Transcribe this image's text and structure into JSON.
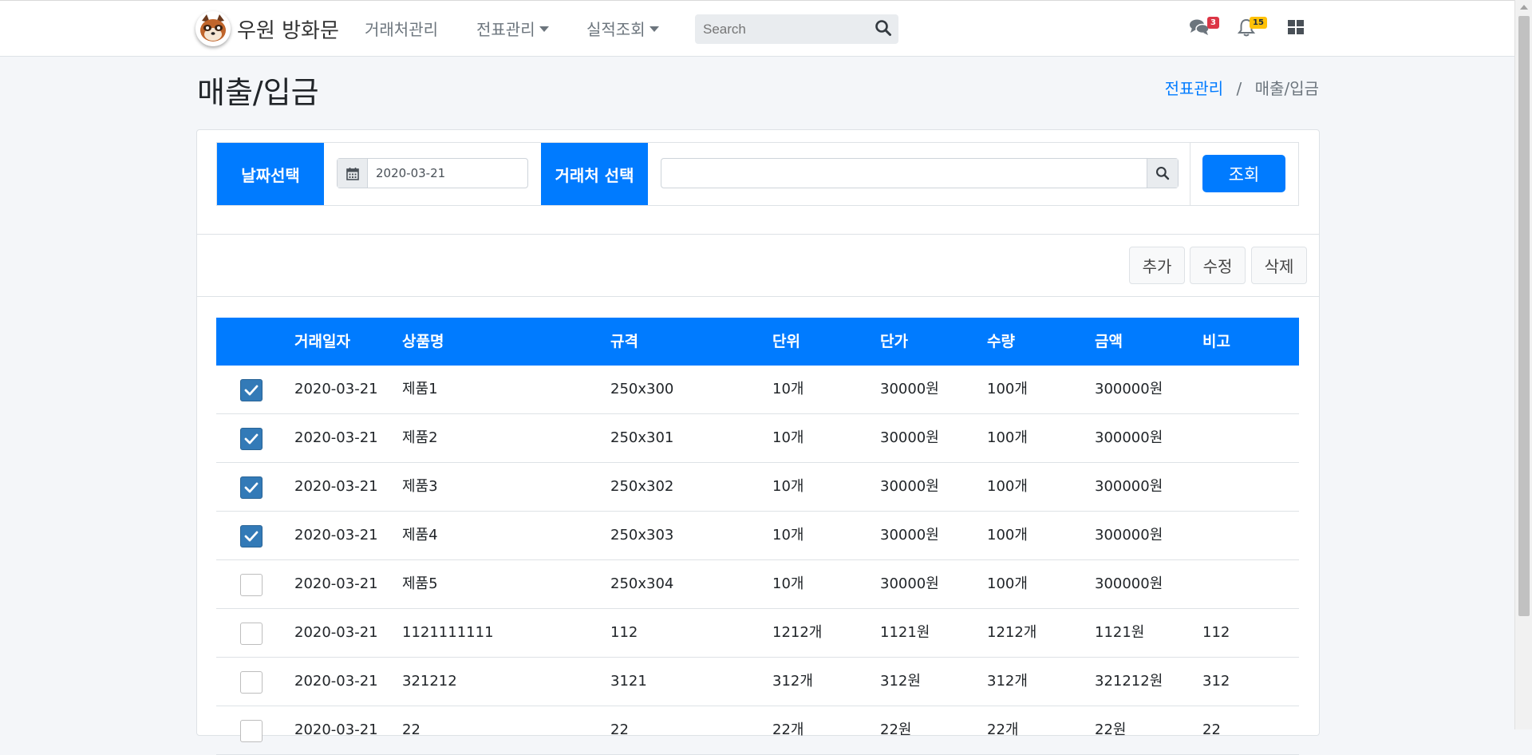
{
  "navbar": {
    "brand": "우원 방화문",
    "menu": [
      "거래처관리",
      "전표관리",
      "실적조회"
    ],
    "search_placeholder": "Search",
    "message_count": "3",
    "notification_count": "15"
  },
  "page": {
    "title": "매출/입금",
    "breadcrumb": [
      "전표관리",
      "/",
      "매출/입금"
    ]
  },
  "filter": {
    "date_label": "날짜선택",
    "date_value": "2020-03-21",
    "customer_label": "거래처 선택",
    "customer_value": "",
    "query_button": "조회"
  },
  "actions": {
    "add": "추가",
    "edit": "수정",
    "delete": "삭제"
  },
  "table": {
    "columns": [
      "거래일자",
      "상품명",
      "규격",
      "단위",
      "단가",
      "수량",
      "금액",
      "비고"
    ],
    "rows": [
      {
        "checked": true,
        "date": "2020-03-21",
        "product": "제품1",
        "spec": "250x300",
        "unit": "10개",
        "price": "30000원",
        "qty": "100개",
        "amount": "300000원",
        "note": ""
      },
      {
        "checked": true,
        "date": "2020-03-21",
        "product": "제품2",
        "spec": "250x301",
        "unit": "10개",
        "price": "30000원",
        "qty": "100개",
        "amount": "300000원",
        "note": ""
      },
      {
        "checked": true,
        "date": "2020-03-21",
        "product": "제품3",
        "spec": "250x302",
        "unit": "10개",
        "price": "30000원",
        "qty": "100개",
        "amount": "300000원",
        "note": ""
      },
      {
        "checked": true,
        "date": "2020-03-21",
        "product": "제품4",
        "spec": "250x303",
        "unit": "10개",
        "price": "30000원",
        "qty": "100개",
        "amount": "300000원",
        "note": ""
      },
      {
        "checked": false,
        "date": "2020-03-21",
        "product": "제품5",
        "spec": "250x304",
        "unit": "10개",
        "price": "30000원",
        "qty": "100개",
        "amount": "300000원",
        "note": ""
      },
      {
        "checked": false,
        "date": "2020-03-21",
        "product": "1121111111",
        "spec": "112",
        "unit": "1212개",
        "price": "1121원",
        "qty": "1212개",
        "amount": "1121원",
        "note": "112"
      },
      {
        "checked": false,
        "date": "2020-03-21",
        "product": "321212",
        "spec": "3121",
        "unit": "312개",
        "price": "312원",
        "qty": "312개",
        "amount": "321212원",
        "note": "312"
      },
      {
        "checked": false,
        "date": "2020-03-21",
        "product": "22",
        "spec": "22",
        "unit": "22개",
        "price": "22원",
        "qty": "22개",
        "amount": "22원",
        "note": "22"
      }
    ]
  },
  "colors": {
    "primary": "#007bff",
    "checkbox_checked": "#337ab7",
    "badge_danger": "#dc3545",
    "badge_warning": "#ffc107"
  }
}
